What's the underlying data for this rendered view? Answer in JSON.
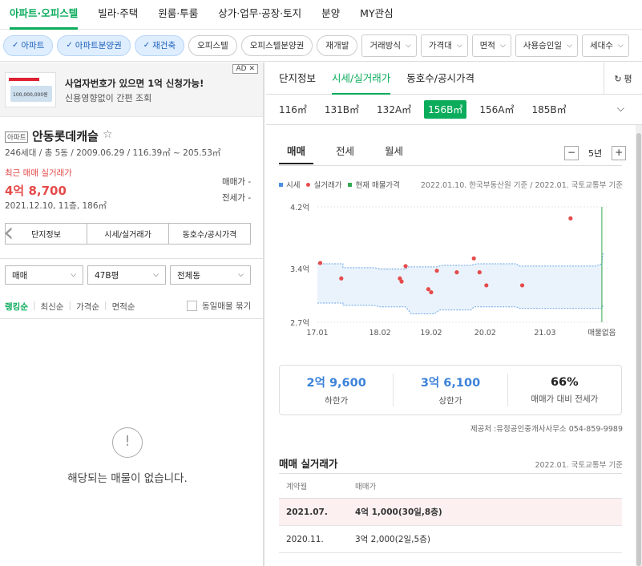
{
  "topnav": {
    "tabs": [
      "아파트·오피스텔",
      "빌라·주택",
      "원룸·투룸",
      "상가·업무·공장·토지",
      "분양",
      "MY관심"
    ],
    "active": 0
  },
  "filters": {
    "chips": [
      {
        "label": "아파트",
        "on": true
      },
      {
        "label": "아파트분양권",
        "on": true
      },
      {
        "label": "재건축",
        "on": true
      },
      {
        "label": "오피스텔",
        "on": false
      },
      {
        "label": "오피스텔분양권",
        "on": false
      },
      {
        "label": "재개발",
        "on": false
      }
    ],
    "dropdowns": [
      "거래방식",
      "가격대",
      "면적",
      "사용승인일",
      "세대수"
    ]
  },
  "ad": {
    "tag": "AD",
    "close": "✕",
    "title": "사업자번호가 있으면 1억 신청가능!",
    "subtitle": "신용영향없이 간편 조회",
    "thumb_text": "100,000,000원"
  },
  "complex": {
    "type_tag": "아파트",
    "name": "안동롯데캐슬",
    "meta": "246세대 / 총 5동 / 2009.06.29 / 116.39㎡ ~ 205.53㎡",
    "recent_label": "최근 매매 실거래가",
    "recent_price": "4억 8,700",
    "recent_detail": "2021.12.10, 11층, 186㎡",
    "sale_label": "매매가 -",
    "jeonse_label": "전세가 -",
    "buttons": [
      "단지정보",
      "시세/실거래가",
      "동호수/공시가격"
    ]
  },
  "left_filters": {
    "trade": "매매",
    "size": "47B평",
    "dong": "전체동"
  },
  "sort": {
    "options": [
      "랭킹순",
      "최신순",
      "가격순",
      "면적순"
    ],
    "active": 0,
    "group_label": "동일매물 묶기"
  },
  "empty": {
    "icon": "!",
    "text": "해당되는 매물이 없습니다."
  },
  "right": {
    "tabs": [
      "단지정보",
      "시세/실거래가",
      "동호수/공시가격"
    ],
    "active_tab": 1,
    "refresh": "평",
    "sizes": [
      "116㎡",
      "131B㎡",
      "132A㎡",
      "156B㎡",
      "156A㎡",
      "185B㎡"
    ],
    "active_size": 3,
    "deal_tabs": [
      "매매",
      "전세",
      "월세"
    ],
    "active_deal": 0,
    "period": {
      "minus": "−",
      "value": "5년",
      "plus": "+"
    }
  },
  "legend": {
    "items": [
      {
        "label": "시세",
        "color": "#4a90e2"
      },
      {
        "label": "실거래가",
        "color": "#e54b4b"
      },
      {
        "label": "현재 매물가격",
        "color": "#34a853"
      }
    ],
    "basis": "2022.01.10. 한국부동산원 기준 / 2022.01. 국토교통부 기준"
  },
  "chart_data": {
    "type": "scatter",
    "y_ticks": [
      "4.2억",
      "3.4억",
      "2.7억"
    ],
    "x_ticks": [
      "17.01",
      "18.02",
      "19.02",
      "20.02",
      "21.03",
      "매물없음"
    ],
    "ylim": [
      2.7,
      4.2
    ],
    "xlim": [
      2017.0,
      2022.1
    ],
    "band_upper": [
      [
        2017.0,
        3.46
      ],
      [
        2017.45,
        3.46
      ],
      [
        2017.45,
        3.41
      ],
      [
        2018.0,
        3.41
      ],
      [
        2018.1,
        3.39
      ],
      [
        2018.55,
        3.39
      ],
      [
        2018.6,
        3.42
      ],
      [
        2019.1,
        3.42
      ],
      [
        2019.2,
        3.44
      ],
      [
        2019.7,
        3.44
      ],
      [
        2019.8,
        3.46
      ],
      [
        2020.5,
        3.46
      ],
      [
        2020.55,
        3.43
      ],
      [
        2021.3,
        3.43
      ],
      [
        2021.9,
        3.43
      ],
      [
        2022.0,
        3.46
      ],
      [
        2022.02,
        3.6
      ]
    ],
    "band_lower": [
      [
        2017.0,
        2.95
      ],
      [
        2017.45,
        2.95
      ],
      [
        2017.45,
        2.92
      ],
      [
        2018.0,
        2.92
      ],
      [
        2018.1,
        2.9
      ],
      [
        2018.55,
        2.9
      ],
      [
        2018.65,
        2.81
      ],
      [
        2019.05,
        2.81
      ],
      [
        2019.15,
        2.86
      ],
      [
        2019.7,
        2.86
      ],
      [
        2019.75,
        2.9
      ],
      [
        2020.5,
        2.9
      ],
      [
        2020.55,
        2.88
      ],
      [
        2021.3,
        2.88
      ],
      [
        2021.9,
        2.88
      ],
      [
        2022.0,
        2.88
      ],
      [
        2022.02,
        2.92
      ]
    ],
    "points": [
      {
        "x": 2017.05,
        "y": 3.47
      },
      {
        "x": 2017.42,
        "y": 3.27
      },
      {
        "x": 2018.45,
        "y": 3.27
      },
      {
        "x": 2018.48,
        "y": 3.23
      },
      {
        "x": 2018.55,
        "y": 3.43
      },
      {
        "x": 2018.95,
        "y": 3.13
      },
      {
        "x": 2019.0,
        "y": 3.09
      },
      {
        "x": 2019.1,
        "y": 3.37
      },
      {
        "x": 2019.45,
        "y": 3.35
      },
      {
        "x": 2019.75,
        "y": 3.53
      },
      {
        "x": 2019.85,
        "y": 3.35
      },
      {
        "x": 2019.97,
        "y": 3.18
      },
      {
        "x": 2020.6,
        "y": 3.18
      },
      {
        "x": 2021.45,
        "y": 4.05
      }
    ],
    "current_marker_x": 2022.0
  },
  "stats": [
    {
      "value": "2억 9,600",
      "label": "하한가"
    },
    {
      "value": "3억 6,100",
      "label": "상한가"
    },
    {
      "value": "66%",
      "label": "매매가 대비 전세가"
    }
  ],
  "provider": "제공처 :유정공인중개사사무소 054-859-9989",
  "transactions": {
    "title": "매매 실거래가",
    "basis": "2022.01. 국토교통부 기준",
    "headers": [
      "계약월",
      "매매가"
    ],
    "rows": [
      {
        "month": "2021.07.",
        "price": "4억 1,000(30일,8층)",
        "highlight": true
      },
      {
        "month": "2020.11.",
        "price": "3억 2,000(2일,5층)",
        "highlight": false
      }
    ]
  }
}
